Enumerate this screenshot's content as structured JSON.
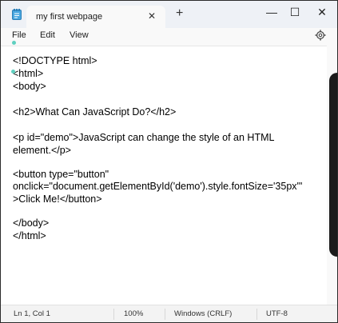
{
  "tab": {
    "title": "my first webpage"
  },
  "menu": {
    "file": "File",
    "edit": "Edit",
    "view": "View"
  },
  "editor": {
    "lines": [
      "<!DOCTYPE html>",
      "<html>",
      "<body>",
      "",
      "<h2>What Can JavaScript Do?</h2>",
      "",
      "<p id=\"demo\">JavaScript can change the style of an HTML",
      "element.</p>",
      "",
      "<button type=\"button\"",
      "onclick=\"document.getElementById('demo').style.fontSize='35px'\"",
      ">Click Me!</button>",
      "",
      "</body>",
      "</html>"
    ]
  },
  "status": {
    "position": "Ln 1, Col 1",
    "zoom": "100%",
    "line_ending": "Windows (CRLF)",
    "encoding": "UTF-8"
  },
  "icons": {
    "app": "notepad-icon",
    "close_tab": "close-icon",
    "new_tab": "plus-icon",
    "minimize": "minimize-icon",
    "maximize": "maximize-icon",
    "close_window": "close-icon",
    "settings": "gear-icon"
  }
}
